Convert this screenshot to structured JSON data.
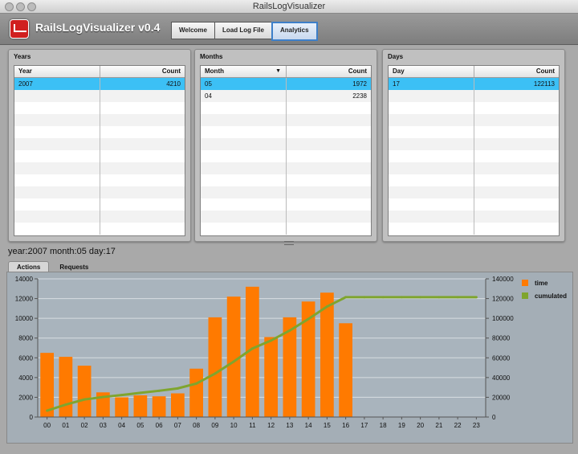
{
  "window": {
    "title": "RailsLogVisualizer"
  },
  "app": {
    "title": "RailsLogVisualizer v0.4"
  },
  "nav": [
    {
      "label": "Welcome",
      "active": false
    },
    {
      "label": "Load Log File",
      "active": false
    },
    {
      "label": "Analytics",
      "active": true
    }
  ],
  "panels": {
    "years": {
      "title": "Years",
      "col1": "Year",
      "col2": "Count",
      "rows": [
        {
          "key": "2007",
          "count": "4210",
          "selected": true
        }
      ]
    },
    "months": {
      "title": "Months",
      "col1": "Month",
      "col2": "Count",
      "rows": [
        {
          "key": "05",
          "count": "1972",
          "selected": true
        },
        {
          "key": "04",
          "count": "2238",
          "selected": false
        }
      ]
    },
    "days": {
      "title": "Days",
      "col1": "Day",
      "col2": "Count",
      "rows": [
        {
          "key": "17",
          "count": "122113",
          "selected": true
        }
      ]
    }
  },
  "status": "year:2007 month:05 day:17",
  "tabs": [
    {
      "label": "Actions",
      "active": true
    },
    {
      "label": "Requests",
      "active": false
    }
  ],
  "chart_data": {
    "type": "bar",
    "categories": [
      "00",
      "01",
      "02",
      "03",
      "04",
      "05",
      "06",
      "07",
      "08",
      "09",
      "10",
      "11",
      "12",
      "13",
      "14",
      "15",
      "16",
      "17",
      "18",
      "19",
      "20",
      "21",
      "22",
      "23"
    ],
    "series": [
      {
        "name": "time",
        "type": "bar",
        "axis": "left",
        "color": "#ff7a00",
        "values": [
          6500,
          6100,
          5200,
          2500,
          2000,
          2200,
          2100,
          2400,
          4900,
          10100,
          12200,
          13200,
          8100,
          10100,
          11700,
          12600,
          9500,
          0,
          0,
          0,
          0,
          0,
          0,
          0
        ]
      },
      {
        "name": "cumulated",
        "type": "line",
        "axis": "right",
        "color": "#7fa52e",
        "values": [
          6500,
          12600,
          17800,
          20300,
          22300,
          24500,
          26600,
          29000,
          33900,
          44000,
          56200,
          69400,
          77500,
          87600,
          99300,
          111900,
          121400,
          121400,
          121400,
          121400,
          121400,
          121400,
          121400,
          121400
        ]
      }
    ],
    "ylim_left": [
      0,
      14000
    ],
    "ylim_right": [
      0,
      140000
    ],
    "yticks_left": [
      "0",
      "2000",
      "4000",
      "6000",
      "8000",
      "10000",
      "12000",
      "14000"
    ],
    "yticks_right": [
      "0",
      "20000",
      "40000",
      "60000",
      "80000",
      "100000",
      "120000",
      "140000"
    ],
    "grid": true,
    "legend": "right"
  }
}
